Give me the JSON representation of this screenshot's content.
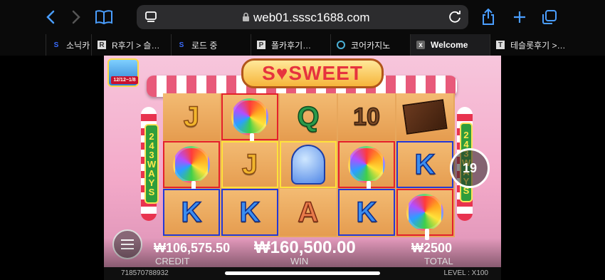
{
  "browser": {
    "url": "web01.sssc1688.com",
    "tabs": [
      {
        "label": "소닉카",
        "favicon": "S"
      },
      {
        "label": "R후기 > 슬…",
        "favicon": "R"
      },
      {
        "label": "로드 중",
        "favicon": "S"
      },
      {
        "label": "폴카후기…",
        "favicon": "P"
      },
      {
        "label": "코어카지노",
        "favicon": "O"
      },
      {
        "label": "Welcome",
        "favicon": "x"
      },
      {
        "label": "테슬롯후기 >…",
        "favicon": "T"
      }
    ]
  },
  "game": {
    "logo": "S♥SWEET",
    "badge_date": "12/12~1/8",
    "ways_text": [
      "2",
      "4",
      "3",
      "W",
      "A",
      "Y",
      "S"
    ],
    "ways_right": [
      "2",
      "4",
      "3",
      "W",
      "A",
      "Y",
      "S"
    ],
    "grid": [
      [
        {
          "sym": "J",
          "box": ""
        },
        {
          "sym": "lolly",
          "box": "red"
        },
        {
          "sym": "Q",
          "box": ""
        },
        {
          "sym": "10",
          "box": ""
        },
        {
          "sym": "choco",
          "box": ""
        }
      ],
      [
        {
          "sym": "lolly",
          "box": "red"
        },
        {
          "sym": "J",
          "box": "yellow"
        },
        {
          "sym": "gum",
          "box": "yellow"
        },
        {
          "sym": "lolly",
          "box": "red"
        },
        {
          "sym": "K",
          "box": "blue"
        }
      ],
      [
        {
          "sym": "K",
          "box": "blue"
        },
        {
          "sym": "K",
          "box": "blue"
        },
        {
          "sym": "A",
          "box": ""
        },
        {
          "sym": "K",
          "box": "blue"
        },
        {
          "sym": "lolly",
          "box": "red"
        }
      ]
    ],
    "spin_count": "19",
    "credit": "₩106,575.50",
    "credit_label": "CREDIT",
    "win": "₩160,500.00",
    "win_label": "WIN",
    "total": "₩2500",
    "total_label": "TOTAL",
    "game_id": "718570788932",
    "level": "LEVEL : X100"
  }
}
